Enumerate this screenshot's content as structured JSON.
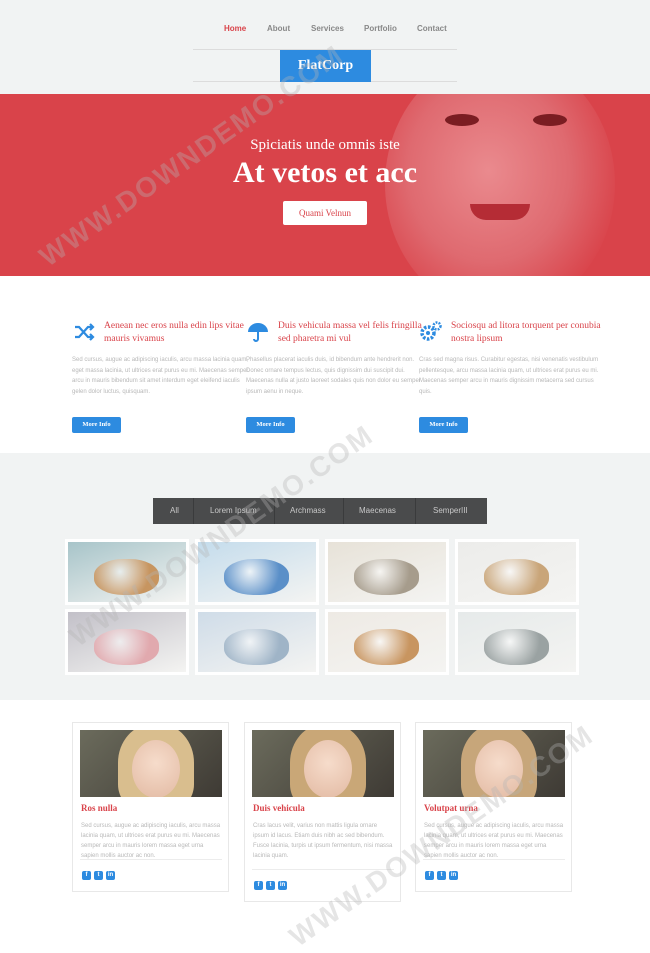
{
  "nav": {
    "items": [
      {
        "label": "Home",
        "active": true
      },
      {
        "label": "About",
        "active": false
      },
      {
        "label": "Services",
        "active": false
      },
      {
        "label": "Portfolio",
        "active": false
      },
      {
        "label": "Contact",
        "active": false
      }
    ]
  },
  "logo": "FlatCorp",
  "hero": {
    "subtitle": "Spiciatis unde omnis iste",
    "title": "At vetos et acc",
    "button": "Quami Velnun"
  },
  "features": [
    {
      "icon": "shuffle-icon",
      "title": "Aenean nec eros nulla edin lips vitae mauris vivamus",
      "text": "Sed cursus, augue ac adipiscing iaculis, arcu massa lacinia quam, eget massa lacinia, ut ultrices erat purus eu mi. Maecenas semper arcu in mauris bibendum sit amet interdum eget eleifend iaculis gelen dolor luctus, quisquam.",
      "button": "More Info"
    },
    {
      "icon": "umbrella-icon",
      "title": "Duis vehicula massa vel felis fringilla sed pharetra mi vul",
      "text": "Phasellus placerat iaculis duis, id bibendum ante hendrerit non. Donec ornare tempus lectus, quis dignissim dui suscipit dui. Maecenas nulla at justo laoreet sodales quis non dolor eu semper ipsum aenu in neque.",
      "button": "More Info"
    },
    {
      "icon": "gears-icon",
      "title": "Sociosqu ad litora torquent per conubia nostra lipsum",
      "text": "Cras sed magna risus. Curabitur egestas, nisi venenatis vestibulum pellentesque, arcu massa lacinia quam, ut ultrices erat purus eu mi. Maecenas semper arcu in mauris dignissim metacerra sed cursus quis.",
      "button": "More Info"
    }
  ],
  "portfolio": {
    "filters": [
      "All",
      "Lorem Ipsum",
      "Archmass",
      "Maecenas",
      "SemperIII"
    ],
    "tiles": [
      {
        "name": "cookies-tile",
        "colors": [
          "#a7c4c9",
          "#c79560"
        ]
      },
      {
        "name": "cushions-tile",
        "colors": [
          "#c4dcec",
          "#5a8fc8"
        ]
      },
      {
        "name": "chair-tile",
        "colors": [
          "#e7e2d8",
          "#a69c8c"
        ]
      },
      {
        "name": "kitchenware-tile",
        "colors": [
          "#ececea",
          "#c9a579"
        ]
      },
      {
        "name": "candles-tile",
        "colors": [
          "#c2c0c8",
          "#e1a9ae"
        ]
      },
      {
        "name": "towels-tile",
        "colors": [
          "#cfdce8",
          "#9fb4c7"
        ]
      },
      {
        "name": "bread-tile",
        "colors": [
          "#eeeae4",
          "#c89560"
        ]
      },
      {
        "name": "clock-tile",
        "colors": [
          "#e6eaea",
          "#9aa2a2"
        ]
      }
    ]
  },
  "team": [
    {
      "name": "Ros nulla",
      "bio": "Sed cursus, augue ac adipiscing iaculis, arcu massa lacinia quam, ut ultrices erat purus eu mi. Maecenas semper arcu in mauris lorem massa eget urna sapien mollis auctor ac non.",
      "hair": "#d9be8e"
    },
    {
      "name": "Duis vehicula",
      "bio": "Cras lacus velit, varius non mattis ligula ornare ipsum id lacus. Etiam duis nibh ac sed bibendum. Fusce lacinia, turpis ut ipsum fermentum, nisi massa lacinia quam.",
      "hair": "#c9a777"
    },
    {
      "name": "Volutpat urna",
      "bio": "Sed cursus, augue ac adipiscing iaculis, arcu massa lacinia quam, ut ultrices erat purus eu mi. Maecenas semper arcu in mauris lorem massa eget urna sapien mollis auctor ac non.",
      "hair": "#c7a67a"
    }
  ],
  "social": [
    "f",
    "t",
    "in"
  ],
  "watermark": "WWW.DOWNDEMO.COM",
  "colors": {
    "accent": "#d9434a",
    "primary": "#2d8be0"
  }
}
